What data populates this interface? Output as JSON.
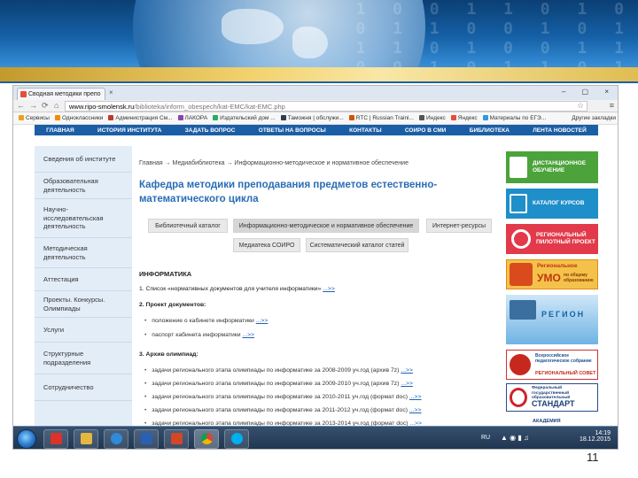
{
  "browser": {
    "tab_title": "Сводная методики препо",
    "tab_close": "×",
    "window_controls": "– ▢ ×",
    "url_host": "www.ripo-smolensk.ru",
    "url_path": "/biblioteka/inform_obespech/kat-EMC/kat-EMC.php",
    "bookmarks": [
      {
        "label": "Сервисы",
        "color": "#e8a317"
      },
      {
        "label": "Одноклассники",
        "color": "#f28c00"
      },
      {
        "label": "Администрация См...",
        "color": "#c0392b"
      },
      {
        "label": "ЛАКОРА",
        "color": "#8e44ad"
      },
      {
        "label": "Издательский дом ...",
        "color": "#27ae60"
      },
      {
        "label": "Таможня | обслужи...",
        "color": "#2c3e50"
      },
      {
        "label": "RTC | Russian Traini...",
        "color": "#d35400"
      },
      {
        "label": "Индекс",
        "color": "#555555"
      },
      {
        "label": "Яндекс",
        "color": "#e74c3c"
      },
      {
        "label": "Материалы по ЕГЭ...",
        "color": "#3498db"
      }
    ],
    "bookmarks_other": "Другие закладки"
  },
  "site_nav": [
    "ГЛАВНАЯ",
    "ИСТОРИЯ ИНСТИТУТА",
    "ЗАДАТЬ ВОПРОС",
    "ОТВЕТЫ НА ВОПРОСЫ",
    "КОНТАКТЫ",
    "СОИРО В СМИ",
    "БИБЛИОТЕКА",
    "ЛЕНТА НОВОСТЕЙ"
  ],
  "sidebar": [
    "Сведения об институте",
    "Образовательная деятельность",
    "Научно-исследовательская деятельность",
    "Методическая деятельность",
    "Аттестация",
    "Проекты. Конкурсы. Олимпиады",
    "Услуги",
    "Структурные подразделения",
    "Сотрудничество"
  ],
  "main": {
    "breadcrumb": "Главная → Медиабиблиотека → Информационно-методическое и нормативное обеспечение",
    "title": "Кафедра методики преподавания предметов естественно-математического цикла",
    "tabs_row1": [
      "Библиотечный каталог",
      "Информационно-методическое и нормативное обеспечение",
      "Интернет-ресурсы"
    ],
    "tabs_row2": [
      "Медиатека СОИРО",
      "Систематический каталог статей"
    ],
    "subject": "ИНФОРМАТИКА",
    "item1": "1. Список «нормативных документов для учителя информатики»",
    "item2": "2. Проект документов:",
    "bullets_2": [
      "положение о кабинете информатики",
      "паспорт кабинета информатики"
    ],
    "item3": "3. Архив олимпиад:",
    "bullets_3": [
      "задачи регионального этапа олимпиады по информатике за 2008-2009 уч.год (архив 7z)",
      "задачи регионального этапа олимпиады по информатике за 2009-2010 уч.год (архив 7z)",
      "задачи регионального этапа олимпиады по информатике за 2010-2011 уч.год (формат doc)",
      "задачи регионального этапа олимпиады по информатике за 2011-2012 уч.год (формат doc)",
      "задачи регионального этапа олимпиады по информатике за 2013-2014 уч.год (формат doc)"
    ],
    "more_link": "...>>"
  },
  "banners": {
    "distance": "ДИСТАНЦИОННОЕ ОБУЧЕНИЕ",
    "catalog": "КАТАЛОГ КУРСОВ",
    "pilot": "РЕГИОНАЛЬНЫЙ ПИЛОТНЫЙ ПРОЕКТ",
    "umo_top": "Региональное",
    "umo_mid": "УМО",
    "umo_side": "по общему образованию",
    "region": "РЕГИОН",
    "council": "Всероссийское педагогическое собрание",
    "council2": "РЕГИОНАЛЬНЫЙ СОВЕТ",
    "fgos": "Федеральный государственный образовательный",
    "standard": "СТАНДАРТ",
    "academy": "АКАДЕМИЯ"
  },
  "taskbar": {
    "lang": "RU",
    "time": "14:19",
    "date": "18.12.2015"
  },
  "slide_number": "11"
}
